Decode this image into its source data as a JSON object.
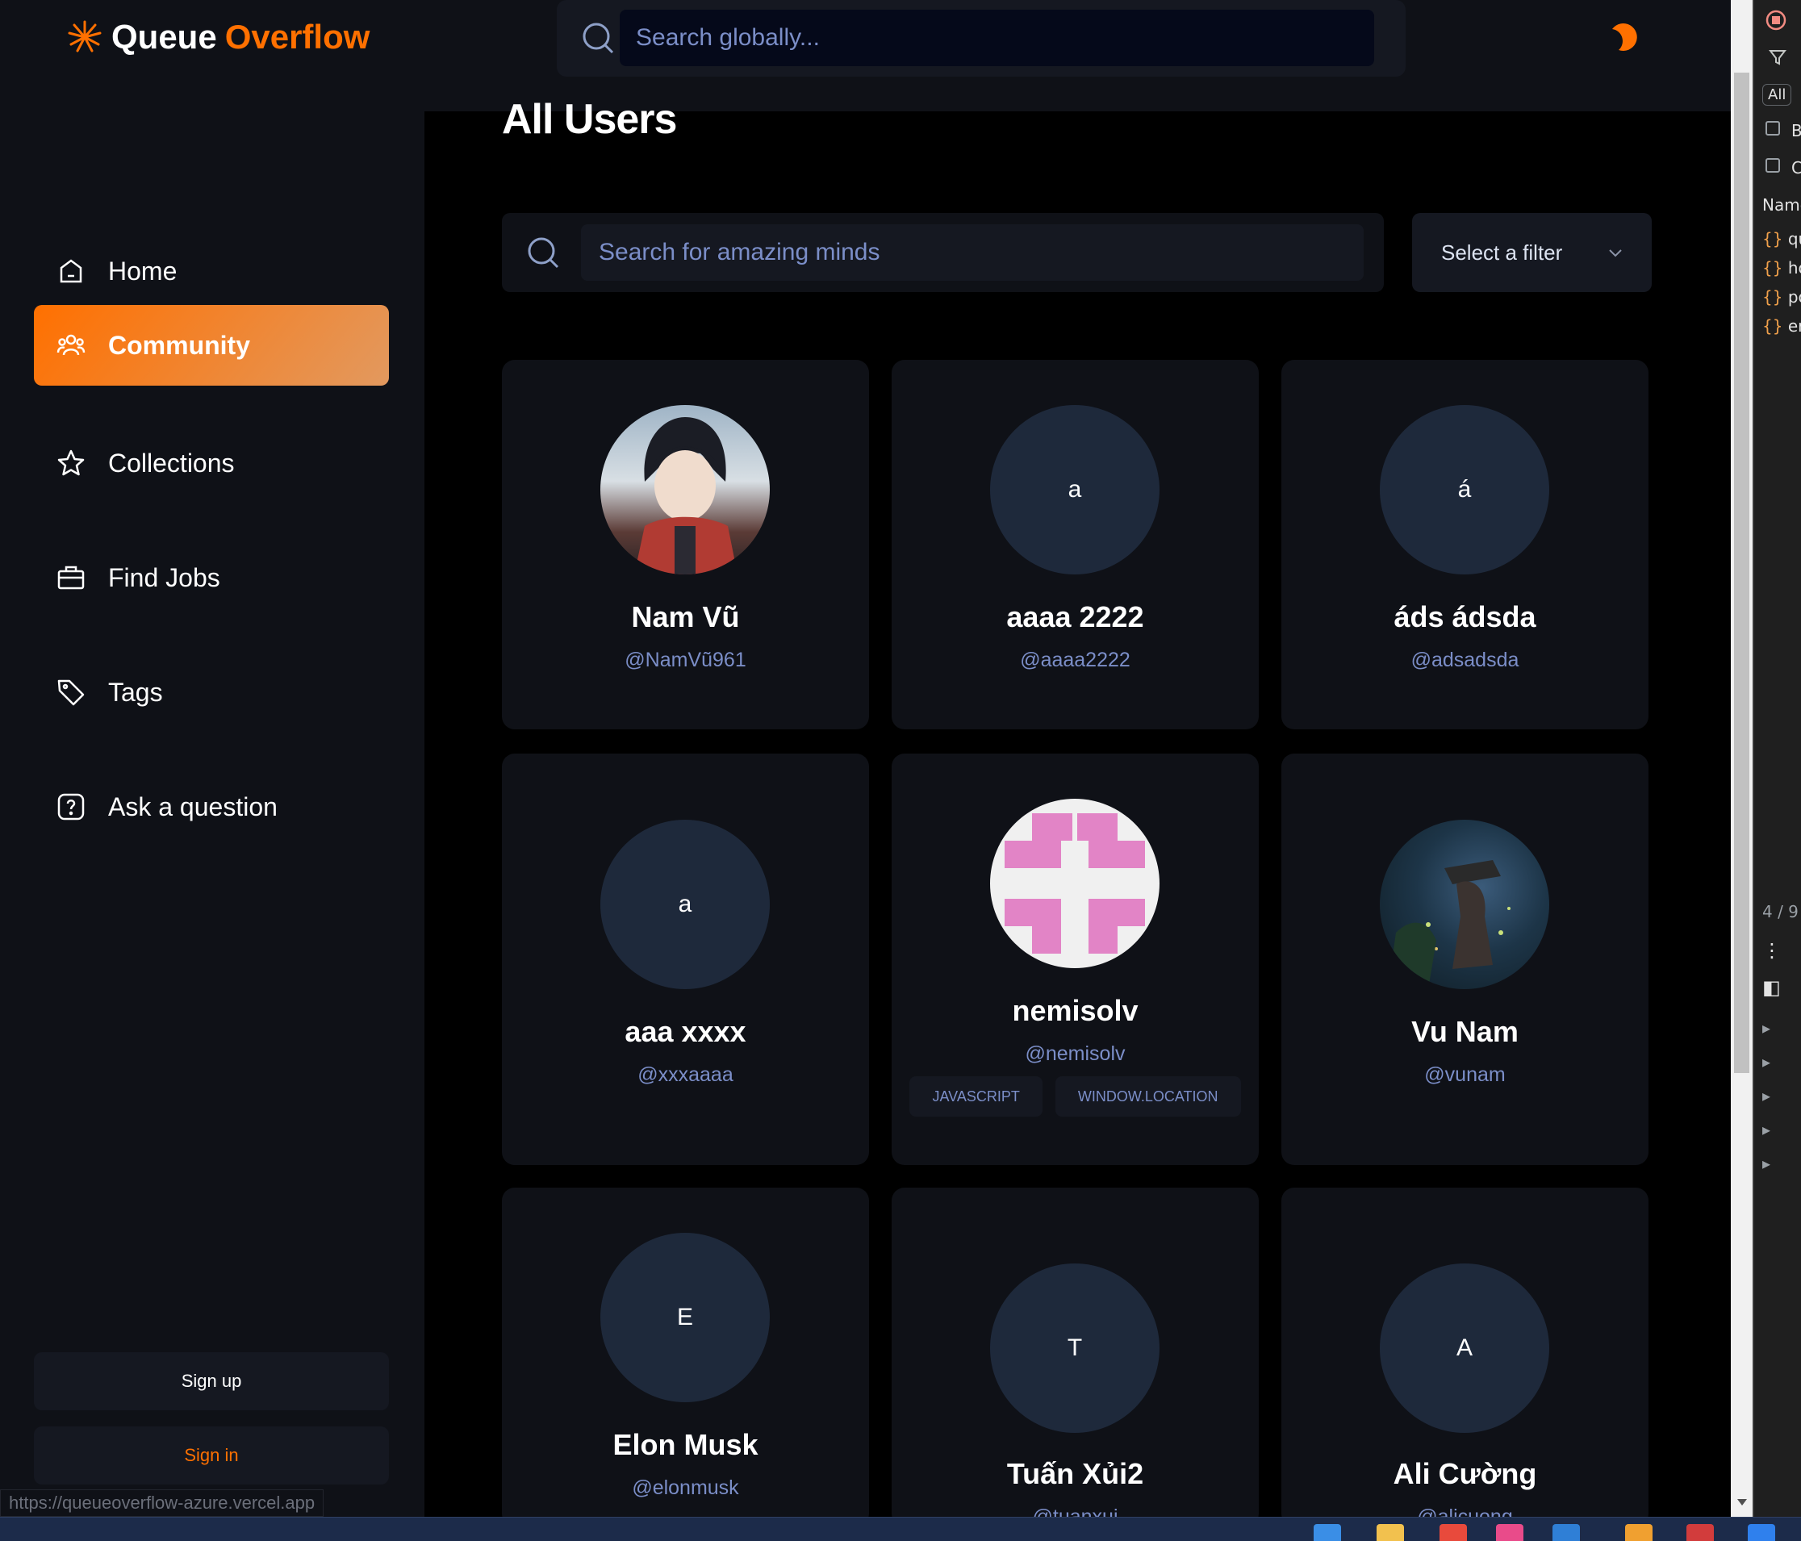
{
  "app": {
    "logo_text_1": "Queue",
    "logo_text_2": "Overflow",
    "brand_color": "#ff7000"
  },
  "global_search": {
    "placeholder": "Search globally..."
  },
  "sidebar": {
    "items": [
      {
        "label": "Home",
        "icon": "home-icon"
      },
      {
        "label": "Community",
        "icon": "users-icon",
        "active": true
      },
      {
        "label": "Collections",
        "icon": "star-icon"
      },
      {
        "label": "Find Jobs",
        "icon": "briefcase-icon"
      },
      {
        "label": "Tags",
        "icon": "tag-icon"
      },
      {
        "label": "Ask a question",
        "icon": "question-icon"
      }
    ],
    "signup_label": "Sign up",
    "signin_label": "Sign in"
  },
  "status_bar": {
    "url": "https://queueoverflow-azure.vercel.app"
  },
  "main": {
    "title": "All Users",
    "search_placeholder": "Search for amazing minds",
    "filter_label": "Select a filter"
  },
  "users": [
    {
      "name": "Nam Vũ",
      "handle": "@NamVũ961",
      "avatar": "image",
      "tags": []
    },
    {
      "name": "aaaa 2222",
      "handle": "@aaaa2222",
      "avatar_initial": "a",
      "tags": []
    },
    {
      "name": "áds ádsda",
      "handle": "@adsadsda",
      "avatar_initial": "á",
      "tags": []
    },
    {
      "name": "aaa xxxx",
      "handle": "@xxxaaaa",
      "avatar_initial": "a",
      "tags": []
    },
    {
      "name": "nemisolv",
      "handle": "@nemisolv",
      "avatar": "identicon",
      "tags": [
        "JAVASCRIPT",
        "WINDOW.LOCATION"
      ]
    },
    {
      "name": "Vu Nam",
      "handle": "@vunam",
      "avatar": "image",
      "tags": []
    },
    {
      "name": "Elon Musk",
      "handle": "@elonmusk",
      "avatar_initial": "E",
      "tags": []
    },
    {
      "name": "Tuấn Xủi2",
      "handle": "@tuanxui",
      "avatar_initial": "T",
      "tags": []
    },
    {
      "name": "Ali Cường",
      "handle": "@alicuong",
      "avatar_initial": "A",
      "tags": []
    }
  ],
  "devtools": {
    "rows": [
      "All",
      "B",
      "C",
      "Name",
      "qu",
      "ho",
      "po",
      "er",
      "4 / 9"
    ]
  }
}
